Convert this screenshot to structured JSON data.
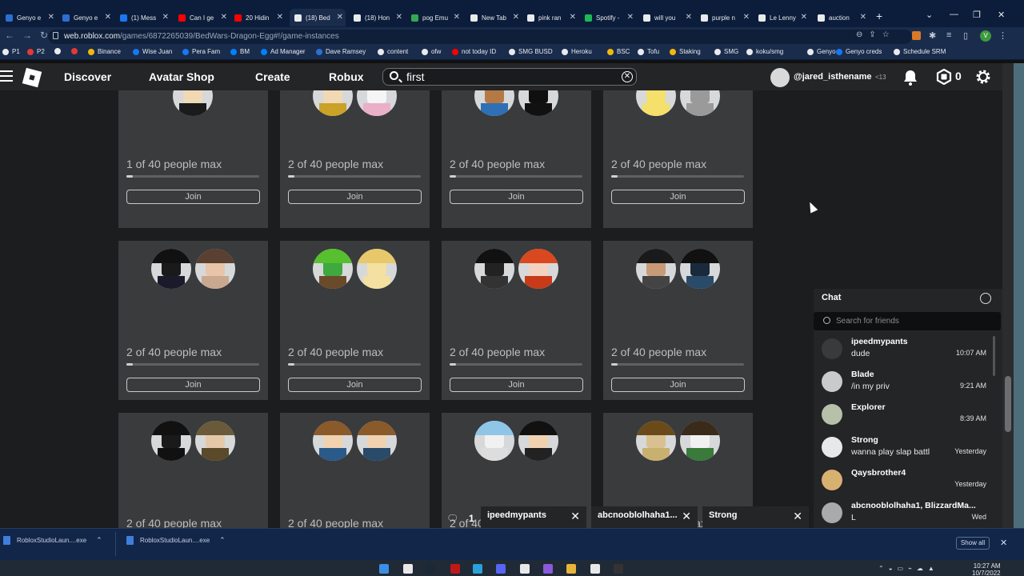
{
  "browser": {
    "tabs": [
      {
        "label": "Genyo e",
        "color": "#2c6fd1"
      },
      {
        "label": "Genyo e",
        "color": "#2c6fd1"
      },
      {
        "label": "(1) Mess",
        "color": "#1877f2"
      },
      {
        "label": "Can I ge",
        "color": "#ff0000"
      },
      {
        "label": "20 Hidin",
        "color": "#ff0000"
      },
      {
        "label": "(18) Bed",
        "color": "#e8eaed"
      },
      {
        "label": "(18) Hon",
        "color": "#e8eaed"
      },
      {
        "label": "pog Emu",
        "color": "#34a853"
      },
      {
        "label": "New Tab",
        "color": "#e8eaed"
      },
      {
        "label": "pink ran",
        "color": "#e8eaed"
      },
      {
        "label": "Spotify -",
        "color": "#1db954"
      },
      {
        "label": "will you",
        "color": "#e8eaed"
      },
      {
        "label": "purple n",
        "color": "#e8eaed"
      },
      {
        "label": "Le Lenny",
        "color": "#e8eaed"
      },
      {
        "label": "auction",
        "color": "#e8eaed"
      }
    ],
    "url_host": "web.roblox.com",
    "url_path": "/games/6872265039/BedWars-Dragon-Egg#!/game-instances",
    "profile_initial": "V",
    "bookmarks": [
      {
        "label": "P1",
        "color": "#e8eaed"
      },
      {
        "label": "P2",
        "color": "#e53935"
      },
      {
        "label": "",
        "color": "#e8eaed"
      },
      {
        "label": "",
        "color": "#e53935"
      },
      {
        "label": "Binance",
        "color": "#f0b90b"
      },
      {
        "label": "Wise Juan",
        "color": "#1877f2"
      },
      {
        "label": "Pera Fam",
        "color": "#1877f2"
      },
      {
        "label": "BM",
        "color": "#0081fb"
      },
      {
        "label": "Ad Manager",
        "color": "#0081fb"
      },
      {
        "label": "Dave Ramsey",
        "color": "#2c6fd1"
      },
      {
        "label": "content",
        "color": "#e8eaed"
      },
      {
        "label": "ofw",
        "color": "#e8eaed"
      },
      {
        "label": "not today ID",
        "color": "#ff0000"
      },
      {
        "label": "SMG BUSD",
        "color": "#e8eaed"
      },
      {
        "label": "Heroku",
        "color": "#e8eaed"
      },
      {
        "label": "BSC",
        "color": "#f0b90b"
      },
      {
        "label": "Tofu",
        "color": "#e8eaed"
      },
      {
        "label": "Staking",
        "color": "#f0b90b"
      },
      {
        "label": "SMG",
        "color": "#e8eaed"
      },
      {
        "label": "koku/smg",
        "color": "#e8eaed"
      },
      {
        "label": "Genyo",
        "color": "#e8eaed"
      },
      {
        "label": "Genyo creds",
        "color": "#1877f2"
      },
      {
        "label": "Schedule SRM",
        "color": "#e8eaed"
      }
    ]
  },
  "header": {
    "nav": [
      "Discover",
      "Avatar Shop",
      "Create",
      "Robux"
    ],
    "search_value": "first",
    "username": "@jared_isthename",
    "age_badge": "<13",
    "robux": "0"
  },
  "servers": {
    "join_label": "Join",
    "rows": [
      [
        {
          "caption": "1 of 40 people max",
          "fill": 0.025,
          "avatars": [
            {
              "skin": "#f1d9b6",
              "hair": "#222",
              "shirt": "#1b1b1b"
            }
          ]
        },
        {
          "caption": "2 of 40 people max",
          "fill": 0.05,
          "avatars": [
            {
              "skin": "#f1d9b6",
              "hair": "#6b4ea8",
              "shirt": "#c9a227"
            },
            {
              "skin": "#f5f5f5",
              "hair": "#e0c0d0",
              "shirt": "#e9b0c8"
            }
          ]
        },
        {
          "caption": "2 of 40 people max",
          "fill": 0.05,
          "avatars": [
            {
              "skin": "#b57a44",
              "hair": "#f0c040",
              "shirt": "#2f6fb5"
            },
            {
              "skin": "#0f0f0f",
              "hair": "#0a0a0a",
              "shirt": "#111"
            }
          ]
        },
        {
          "caption": "2 of 40 people max",
          "fill": 0.05,
          "avatars": [
            {
              "skin": "#f4e06a",
              "hair": "#f0e68c",
              "shirt": "#f4e06a"
            },
            {
              "skin": "#9a9a9a",
              "hair": "#8a8a8a",
              "shirt": "#9a9a9a"
            }
          ]
        }
      ],
      [
        {
          "caption": "2 of 40 people max",
          "fill": 0.05,
          "avatars": [
            {
              "skin": "#1a1a1a",
              "hair": "#111",
              "shirt": "#1a1a2a"
            },
            {
              "skin": "#e8c4a8",
              "hair": "#5a4030",
              "shirt": "#caa890"
            }
          ]
        },
        {
          "caption": "2 of 40 people max",
          "fill": 0.05,
          "avatars": [
            {
              "skin": "#3fa83f",
              "hair": "#56c02e",
              "shirt": "#6b4a2a"
            },
            {
              "skin": "#f4e0a0",
              "hair": "#e8c86a",
              "shirt": "#f4e0a0"
            }
          ]
        },
        {
          "caption": "2 of 40 people max",
          "fill": 0.05,
          "avatars": [
            {
              "skin": "#222",
              "hair": "#111",
              "shirt": "#333"
            },
            {
              "skin": "#f3d2c0",
              "hair": "#d9481f",
              "shirt": "#c73b18"
            }
          ]
        },
        {
          "caption": "2 of 40 people max",
          "fill": 0.05,
          "avatars": [
            {
              "skin": "#c89a78",
              "hair": "#1a1a1a",
              "shirt": "#444"
            },
            {
              "skin": "#1a2a3a",
              "hair": "#111",
              "shirt": "#2a4a6a"
            }
          ]
        }
      ],
      [
        {
          "caption": "2 of 40 people max",
          "fill": 0.05,
          "avatars": [
            {
              "skin": "#1a1a1a",
              "hair": "#111",
              "shirt": "#111"
            },
            {
              "skin": "#e4c8a8",
              "hair": "#6b5a3a",
              "shirt": "#5a4a2a"
            }
          ]
        },
        {
          "caption": "",
          "fill": 0.05,
          "avatars": [
            {
              "skin": "#f1d2b0",
              "hair": "#8a5a2a",
              "shirt": "#2a5a8a"
            },
            {
              "skin": "#f1d2b0",
              "hair": "#8a5a2a",
              "shirt": "#2a4a6a"
            }
          ]
        },
        {
          "caption": "",
          "fill": 0.05,
          "avatars": [
            {
              "skin": "#f1f1f1",
              "hair": "#8fc6e8",
              "shirt": "#ddd"
            },
            {
              "skin": "#f1d2b0",
              "hair": "#111",
              "shirt": "#222"
            }
          ]
        },
        {
          "caption": "",
          "fill": 0.05,
          "avatars": [
            {
              "skin": "#d8c090",
              "hair": "#6b4a1a",
              "shirt": "#c8b070"
            },
            {
              "skin": "#f1f1f1",
              "hair": "#3a2a1a",
              "shirt": "#3a7a3a"
            }
          ]
        }
      ]
    ],
    "partial_caption": "2 of 40 people max"
  },
  "chat": {
    "title": "Chat",
    "search_placeholder": "Search for friends",
    "conversations": [
      {
        "name": "ipeedmypants",
        "message": "dude",
        "time": "10:07 AM",
        "color": "#3a3a3a"
      },
      {
        "name": "Blade",
        "message": "/in my priv",
        "time": "9:21 AM",
        "color": "#c8cacc"
      },
      {
        "name": "Explorer",
        "message": "",
        "time": "8:39 AM",
        "color": "#b7c0a8"
      },
      {
        "name": "Strong",
        "message": "wanna play slap battl",
        "time": "Yesterday",
        "color": "#e8e8e8"
      },
      {
        "name": "Qaysbrother4",
        "message": "",
        "time": "Yesterday",
        "color": "#d8b070"
      },
      {
        "name": "abcnooblolhaha1, BlizzardMa...",
        "message": "L",
        "time": "Wed",
        "color": "#aaa"
      }
    ],
    "unread_count": "1",
    "open_windows": [
      "ipeedmypants",
      "abcnooblolhaha1...",
      "Strong"
    ]
  },
  "downloads": {
    "items": [
      "RobloxStudioLaun....exe",
      "RobloxStudioLaun....exe"
    ],
    "show_all": "Show all"
  },
  "taskbar": {
    "time": "10:27 AM",
    "date": "10/7/2022",
    "icons": [
      {
        "name": "windows-start-icon",
        "color": "#3a8ee6"
      },
      {
        "name": "search-icon",
        "color": "#e8e8e8"
      },
      {
        "name": "steam-icon",
        "color": "#1b2838"
      },
      {
        "name": "bitdefender-icon",
        "color": "#c01818"
      },
      {
        "name": "telegram-icon",
        "color": "#2aa1da"
      },
      {
        "name": "discord-icon",
        "color": "#5865f2"
      },
      {
        "name": "chrome-icon",
        "color": "#e8e8e8"
      },
      {
        "name": "app-icon",
        "color": "#8a5ad8"
      },
      {
        "name": "file-explorer-icon",
        "color": "#e8b43a"
      },
      {
        "name": "roblox-studio-icon",
        "color": "#e8e8e8"
      },
      {
        "name": "obs-icon",
        "color": "#333"
      }
    ]
  }
}
